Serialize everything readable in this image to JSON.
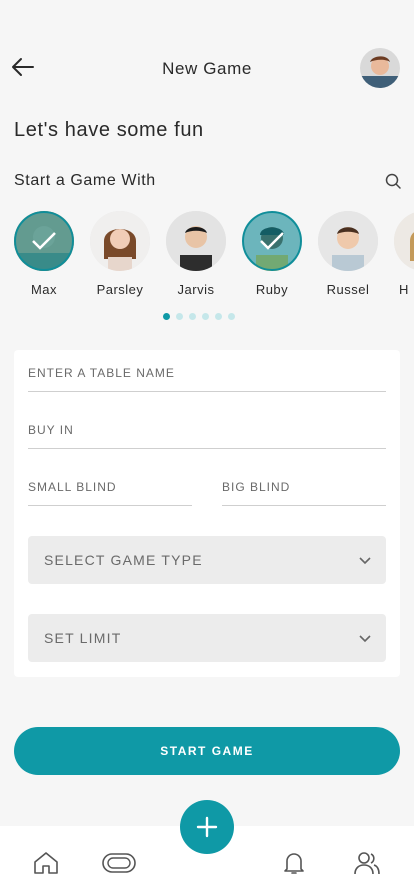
{
  "header": {
    "title": "New Game",
    "back_icon": "arrow-left-icon",
    "avatar_icon": "user-avatar"
  },
  "headline": "Let's have some fun",
  "players_section": {
    "label": "Start a Game With",
    "search_icon": "search-icon",
    "players": [
      {
        "name": "Max",
        "selected": true
      },
      {
        "name": "Parsley",
        "selected": false
      },
      {
        "name": "Jarvis",
        "selected": false
      },
      {
        "name": "Ruby",
        "selected": true
      },
      {
        "name": "Russel",
        "selected": false
      },
      {
        "name": "H",
        "selected": false
      }
    ],
    "pagination": {
      "total": 6,
      "active": 1
    }
  },
  "form": {
    "table_name_placeholder": "ENTER A TABLE NAME",
    "buy_in_placeholder": "BUY IN",
    "small_blind_placeholder": "SMALL BLIND",
    "big_blind_placeholder": "BIG BLIND",
    "game_type_label": "SELECT GAME TYPE",
    "limit_label": "SET LIMIT"
  },
  "start_button_label": "START GAME",
  "bottom_nav": {
    "items": [
      "home-icon",
      "table-icon",
      "bell-icon",
      "users-icon"
    ],
    "fab_icon": "plus-icon"
  },
  "colors": {
    "accent": "#0f99a6",
    "accent_light": "#c5e7ea",
    "background": "#f6f6f6",
    "card": "#ffffff",
    "select_bg": "#ececec"
  }
}
